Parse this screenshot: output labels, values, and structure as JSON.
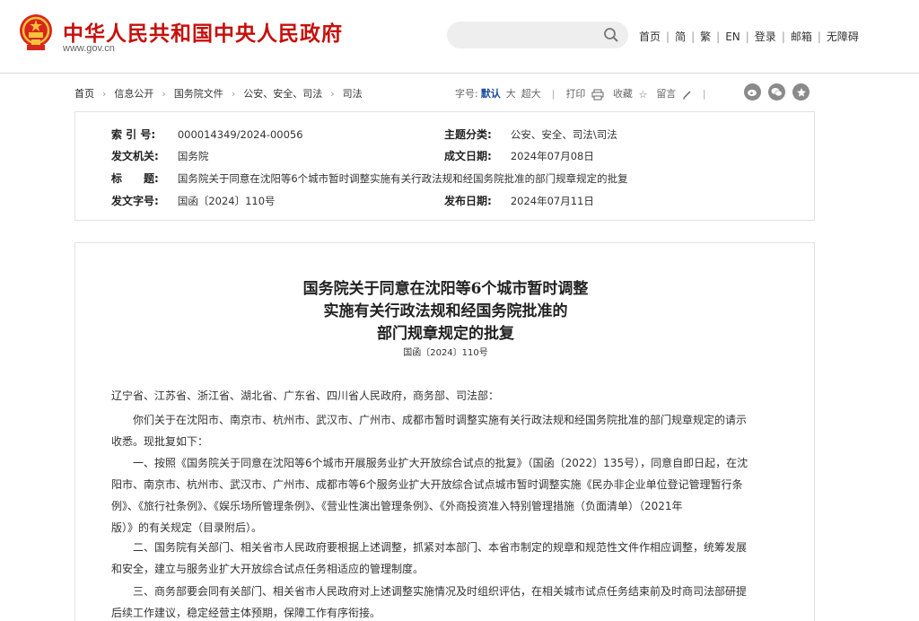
{
  "header": {
    "site_title": "中华人民共和国中央人民政府",
    "site_url": "www.gov.cn",
    "search_placeholder": "",
    "nav": [
      "首页",
      "简",
      "繁",
      "EN",
      "登录",
      "邮箱",
      "无障碍"
    ]
  },
  "breadcrumb": [
    "首页",
    "信息公开",
    "国务院文件",
    "公安、安全、司法",
    "司法"
  ],
  "tools": {
    "font_label": "字号:",
    "font_sizes": [
      "默认",
      "大",
      "超大"
    ],
    "print": "打印",
    "favorite": "收藏",
    "comment": "留言"
  },
  "info": {
    "index_label": "索 引 号:",
    "index_value": "000014349/2024-00056",
    "topic_label": "主题分类:",
    "topic_value": "公安、安全、司法\\司法",
    "issuer_label": "发文机关:",
    "issuer_value": "国务院",
    "date_label": "成文日期:",
    "date_value": "2024年07月08日",
    "title_label": "标　　题:",
    "title_value": "国务院关于同意在沈阳等6个城市暂时调整实施有关行政法规和经国务院批准的部门规章规定的批复",
    "docno_label": "发文字号:",
    "docno_value": "国函〔2024〕110号",
    "pub_label": "发布日期:",
    "pub_value": "2024年07月11日"
  },
  "article": {
    "title_lines": [
      "国务院关于同意在沈阳等6个城市暂时调整",
      "实施有关行政法规和经国务院批准的",
      "部门规章规定的批复"
    ],
    "doc_no": "国函〔2024〕110号",
    "addressee": "辽宁省、江苏省、浙江省、湖北省、广东省、四川省人民政府，商务部、司法部：",
    "p1": [
      "　　你们关于在沈阳市、南京市、杭州市、武汉市、广州市、成都市暂时调整实施有关行政法规和经国务院批准的部门规章规定的请示",
      "收悉。现批复如下："
    ],
    "p2": [
      "　　一、按照《国务院关于同意在沈阳等6个城市开展服务业扩大开放综合试点的批复》（国函〔2022〕135号），同意自即日起，在沈",
      "阳市、南京市、杭州市、武汉市、广州市、成都市等6个服务业扩大开放综合试点城市暂时调整实施《民办非企业单位登记管理暂行条",
      "例》、《旅行社条例》、《娱乐场所管理条例》、《营业性演出管理条例》、《外商投资准入特别管理措施（负面清单）（2021年",
      "版）》的有关规定（目录附后）。"
    ],
    "p3": [
      "　　二、国务院有关部门、相关省市人民政府要根据上述调整，抓紧对本部门、本省市制定的规章和规范性文件作相应调整，统筹发展",
      "和安全，建立与服务业扩大开放综合试点任务相适应的管理制度。"
    ],
    "p4": [
      "　　三、商务部要会同有关部门、相关省市人民政府对上述调整实施情况及时组织评估，在相关城市试点任务结束前及时商司法部研提",
      "后续工作建议，稳定经营主体预期，保障工作有序衔接。"
    ]
  },
  "colors": {
    "brand_red": "#c6100c",
    "link_blue": "#1a4d9c",
    "border": "#e2e2e2"
  }
}
